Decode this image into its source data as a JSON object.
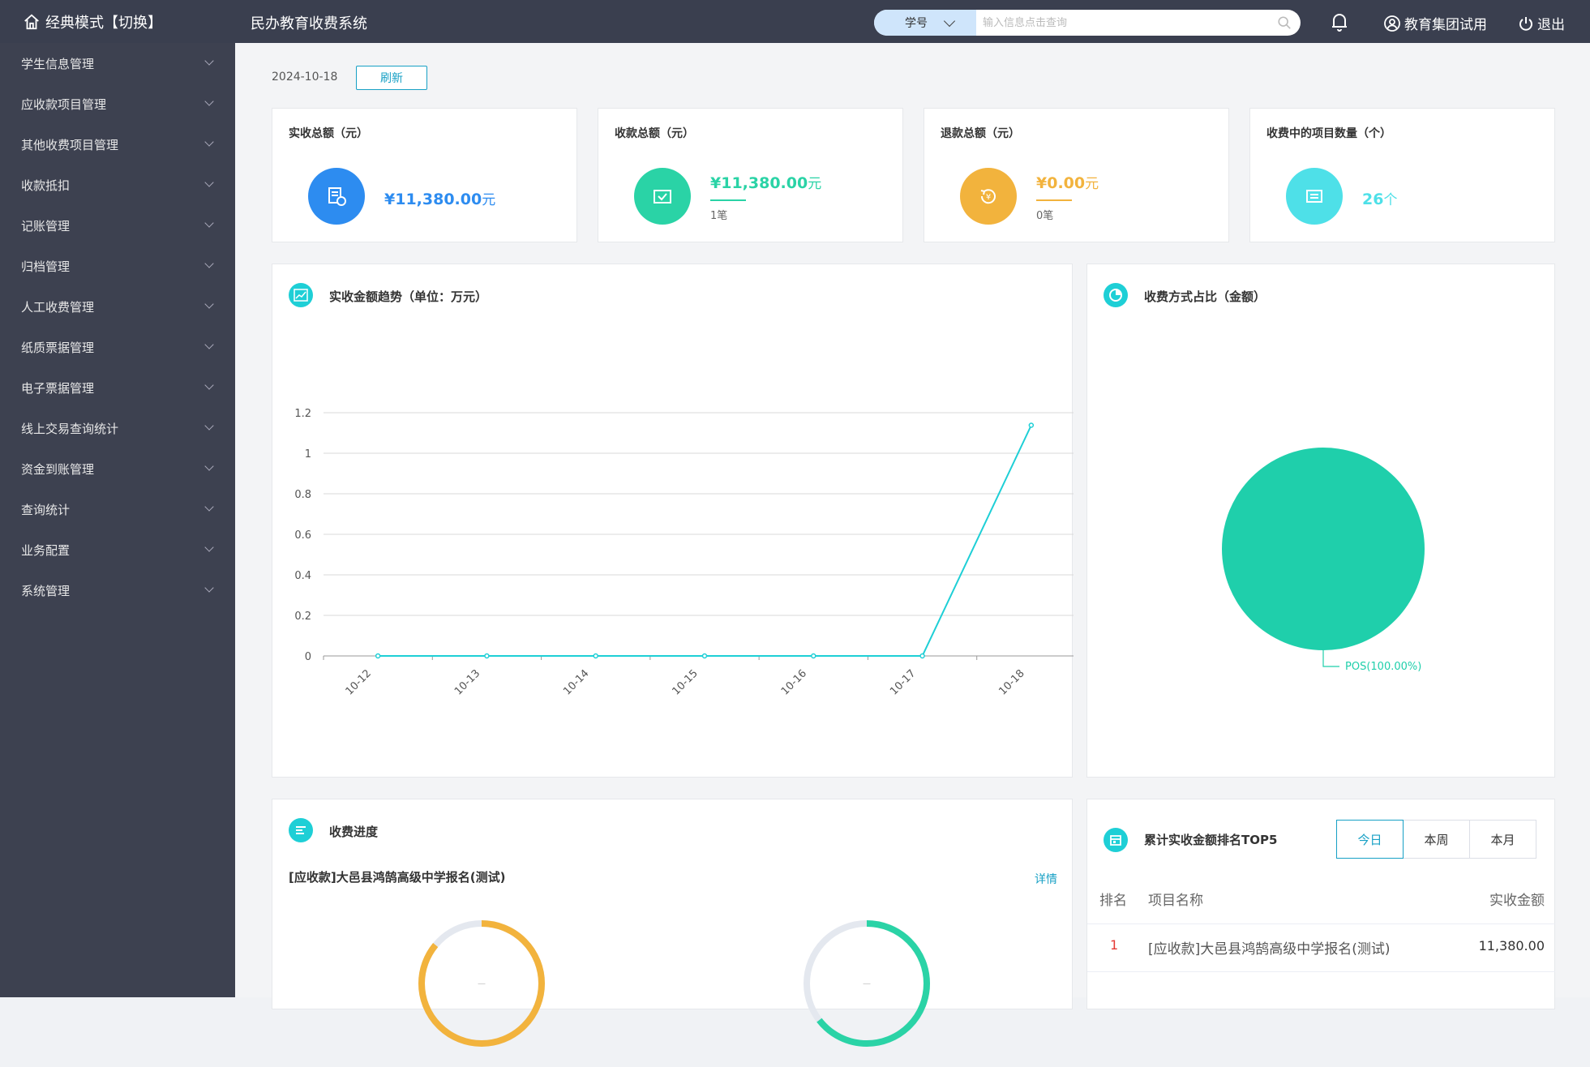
{
  "topbar": {
    "mode_label": "经典模式【切换】",
    "system_title": "民办教育收费系统",
    "search_type": "学号",
    "search_placeholder": "输入信息点击查询",
    "user_label": "教育集团试用",
    "logout_label": "退出"
  },
  "sidebar": {
    "items": [
      {
        "label": "学生信息管理"
      },
      {
        "label": "应收款项目管理"
      },
      {
        "label": "其他收费项目管理"
      },
      {
        "label": "收款抵扣"
      },
      {
        "label": "记账管理"
      },
      {
        "label": "归档管理"
      },
      {
        "label": "人工收费管理"
      },
      {
        "label": "纸质票据管理"
      },
      {
        "label": "电子票据管理"
      },
      {
        "label": "线上交易查询统计"
      },
      {
        "label": "资金到账管理"
      },
      {
        "label": "查询统计"
      },
      {
        "label": "业务配置"
      },
      {
        "label": "系统管理"
      }
    ]
  },
  "toolbar": {
    "date": "2024-10-18",
    "refresh_label": "刷新"
  },
  "stats": [
    {
      "title": "实收总额（元）",
      "value": "¥11,380.00",
      "unit": "元",
      "count": "",
      "color": "#2d8cf0"
    },
    {
      "title": "收款总额（元）",
      "value": "¥11,380.00",
      "unit": "元",
      "count": "1笔",
      "color": "#2ad3a6"
    },
    {
      "title": "退款总额（元）",
      "value": "¥0.00",
      "unit": "元",
      "count": "0笔",
      "color": "#f2b33d"
    },
    {
      "title": "收费中的项目数量（个）",
      "value": "26",
      "unit": "个",
      "count": "",
      "color": "#4ee0e8"
    }
  ],
  "trend": {
    "title": "实收金额趋势（单位：万元）"
  },
  "pie_panel": {
    "title": "收费方式占比（金额）"
  },
  "progress": {
    "title": "收费进度",
    "project": "[应收款]大邑县鸿鹄高级中学报名(测试)",
    "detail_label": "详情",
    "gauge_labels": [
      "—",
      "—"
    ],
    "colors": [
      "#f2b33d",
      "#2ad3a6"
    ]
  },
  "ranking": {
    "title": "累计实收金额排名TOP5",
    "tabs": [
      "今日",
      "本周",
      "本月"
    ],
    "active_tab": 0,
    "headers": [
      "排名",
      "项目名称",
      "实收金额"
    ],
    "rows": [
      {
        "rank": "1",
        "name": "[应收款]大邑县鸿鹄高级中学报名(测试)",
        "amount": "11,380.00"
      }
    ]
  },
  "chart_data": [
    {
      "type": "line",
      "title": "实收金额趋势（单位：万元）",
      "x": [
        "10-12",
        "10-13",
        "10-14",
        "10-15",
        "10-16",
        "10-17",
        "10-18"
      ],
      "series": [
        {
          "values": [
            0,
            0,
            0,
            0,
            0,
            0,
            1.138
          ]
        }
      ],
      "yticks": [
        "0",
        "0.2",
        "0.4",
        "0.6",
        "0.8",
        "1",
        "1.2"
      ],
      "ylim": [
        0,
        1.2
      ],
      "grid": true,
      "color": "#1ecfd6"
    },
    {
      "type": "pie",
      "title": "收费方式占比（金额）",
      "slices": [
        {
          "label": "POS(100.00%)",
          "value": 100
        }
      ],
      "color": "#1fcfab"
    }
  ]
}
